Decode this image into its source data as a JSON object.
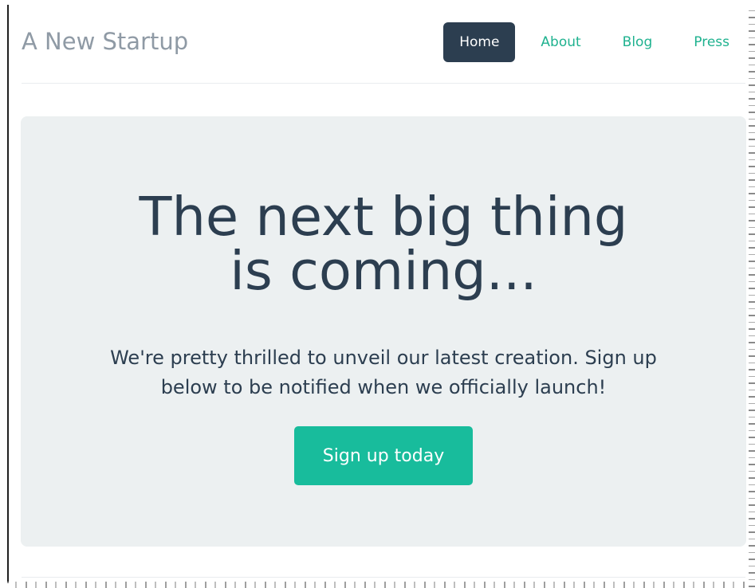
{
  "header": {
    "brand": "A New Startup",
    "nav": [
      {
        "label": "Home",
        "active": true
      },
      {
        "label": "About",
        "active": false
      },
      {
        "label": "Blog",
        "active": false
      },
      {
        "label": "Press",
        "active": false
      }
    ]
  },
  "hero": {
    "title": "The next big thing\nis coming...",
    "subtitle": "We're pretty thrilled to unveil our latest creation. Sign up\nbelow to be notified when we officially launch!",
    "button_label": "Sign up today"
  },
  "colors": {
    "brand_text": "#8f9aa5",
    "nav_active_bg": "#2c3e50",
    "nav_link": "#1fb28f",
    "hero_bg": "#ecf0f1",
    "hero_text": "#2c3e50",
    "button_bg": "#18bc9c"
  }
}
